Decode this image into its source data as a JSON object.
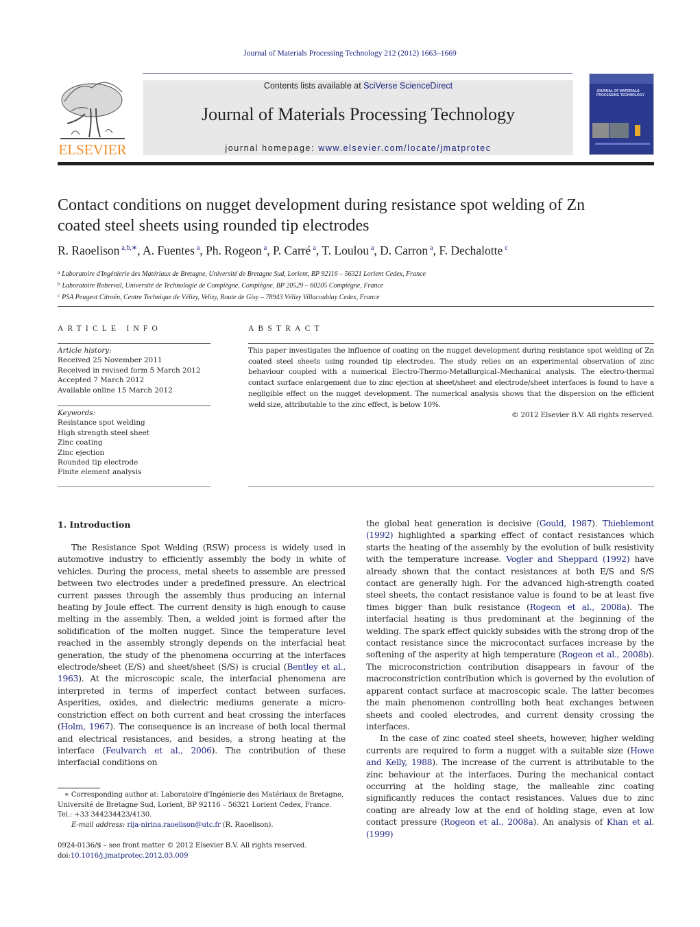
{
  "running_head": "Journal of Materials Processing Technology 212 (2012) 1663–1669",
  "masthead": {
    "contents_prefix": "Contents lists available at ",
    "contents_link": "SciVerse ScienceDirect",
    "journal_name": "Journal of Materials Processing Technology",
    "homepage_prefix": "journal homepage: ",
    "homepage_link": "www.elsevier.com/locate/jmatprotec",
    "publisher_logo_text": "ELSEVIER",
    "cover_title": "JOURNAL OF MATERIALS PROCESSING TECHNOLOGY"
  },
  "colors": {
    "link": "#1a237e",
    "elsevier_orange": "#f28c28",
    "masthead_bg": "#e8e8e8",
    "cover_blue": "#2b3a8f"
  },
  "article": {
    "title_line1": "Contact conditions on nugget development during resistance spot welding of Zn",
    "title_line2": "coated steel sheets using rounded tip electrodes",
    "authors": [
      {
        "name": "R. Raoelison",
        "sup": "a,b,∗"
      },
      {
        "name": "A. Fuentes",
        "sup": "a"
      },
      {
        "name": "Ph. Rogeon",
        "sup": "a"
      },
      {
        "name": "P. Carré",
        "sup": "a"
      },
      {
        "name": "T. Loulou",
        "sup": "a"
      },
      {
        "name": "D. Carron",
        "sup": "a"
      },
      {
        "name": "F. Dechalotte",
        "sup": "c"
      }
    ],
    "affiliations": [
      {
        "key": "a",
        "text": "Laboratoire d'Ingénierie des Matériaux de Bretagne, Université de Bretagne Sud, Lorient, BP 92116 – 56321 Lorient Cedex, France"
      },
      {
        "key": "b",
        "text": "Laboratoire Roberval, Université de Technologie de Compiègne, Compiègne, BP 20529 – 60205 Compiègne, France"
      },
      {
        "key": "c",
        "text": "PSA Peugeot Citroën, Centre Technique de Vélizy, Velizy, Route de Gisy – 78943 Vélizy Villacoublay Cedex, France"
      }
    ]
  },
  "article_info": {
    "heading": "ARTICLE INFO",
    "history_label": "Article history:",
    "history": [
      "Received 25 November 2011",
      "Received in revised form 5 March 2012",
      "Accepted 7 March 2012",
      "Available online 15 March 2012"
    ],
    "keywords_label": "Keywords:",
    "keywords": [
      "Resistance spot welding",
      "High strength steel sheet",
      "Zinc coating",
      "Zinc ejection",
      "Rounded tip electrode",
      "Finite element analysis"
    ]
  },
  "abstract": {
    "heading": "ABSTRACT",
    "text": "This paper investigates the influence of coating on the nugget development during resistance spot welding of Zn coated steel sheets using rounded tip electrodes. The study relies on an experimental observation of zinc behaviour coupled with a numerical Electro-Thermo-Metallurgical–Mechanical analysis. The electro-thermal contact surface enlargement due to zinc ejection at sheet/sheet and electrode/sheet interfaces is found to have a negligible effect on the nugget development. The numerical analysis shows that the dispersion on the efficient weld size, attributable to the zinc effect, is below 10%.",
    "copyright": "© 2012 Elsevier B.V. All rights reserved."
  },
  "body": {
    "section_heading": "1.  Introduction",
    "left_para": [
      {
        "t": "The Resistance Spot Welding (RSW) process is widely used in automotive industry to efficiently assembly the body in white of vehicles. During the process, metal sheets to assemble are pressed between two electrodes under a predefined pressure. An electrical current passes through the assembly thus producing an internal heating by Joule effect. The current density is high enough to cause melting in the assembly. Then, a welded joint is formed after the solidification of the molten nugget. Since the temperature level reached in the assembly strongly depends on the interfacial heat generation, the study of the phenomena occurring at the interfaces electrode/sheet (E/S) and sheet/sheet (S/S) is crucial ("
      },
      {
        "link": "Bentley et al., 1963"
      },
      {
        "t": "). At the microscopic scale, the interfacial phenomena are interpreted in terms of imperfect contact between surfaces. Asperities, oxides, and dielectric mediums generate a micro-constriction effect on both current and heat crossing the interfaces ("
      },
      {
        "link": "Holm, 1967"
      },
      {
        "t": "). The consequence is an increase of both local thermal and electrical resistances, and besides, a strong heating at the interface ("
      },
      {
        "link": "Feulvarch et al., 2006"
      },
      {
        "t": "). The contribution of these interfacial conditions on"
      }
    ],
    "right_para1": [
      {
        "t": "the global heat generation is decisive ("
      },
      {
        "link": "Gould, 1987"
      },
      {
        "t": "). "
      },
      {
        "link": "Thieblemont (1992)"
      },
      {
        "t": " highlighted a sparking effect of contact resistances which starts the heating of the assembly by the evolution of bulk resistivity with the temperature increase. "
      },
      {
        "link": "Vogler and Sheppard (1992)"
      },
      {
        "t": " have already shown that the contact resistances at both E/S and S/S contact are generally high. For the advanced high-strength coated steel sheets, the contact resistance value is found to be at least five times bigger than bulk resistance ("
      },
      {
        "link": "Rogeon et al., 2008a"
      },
      {
        "t": "). The interfacial heating is thus predominant at the beginning of the welding. The spark effect quickly subsides with the strong drop of the contact resistance since the microcontact surfaces increase by the softening of the asperity at high temperature ("
      },
      {
        "link": "Rogeon et al., 2008b"
      },
      {
        "t": "). The microconstriction contribution disappears in favour of the macroconstriction contribution which is governed by the evolution of apparent contact surface at macroscopic scale. The latter becomes the main phenomenon controlling both heat exchanges between sheets and cooled electrodes, and current density crossing the interfaces."
      }
    ],
    "right_para2": [
      {
        "t": "In the case of zinc coated steel sheets, however, higher welding currents are required to form a nugget with a suitable size ("
      },
      {
        "link": "Howe and Kelly, 1988"
      },
      {
        "t": "). The increase of the current is attributable to the zinc behaviour at the interfaces. During the mechanical contact occurring at the holding stage, the malleable zinc coating significantly reduces the contact resistances. Values due to zinc coating are already low at the end of holding stage, even at low contact pressure ("
      },
      {
        "link": "Rogeon et al., 2008a"
      },
      {
        "t": "). An analysis of "
      },
      {
        "link": "Khan et al. (1999)"
      }
    ]
  },
  "footnotes": {
    "corresponding": "∗ Corresponding author at: Laboratoire d'Ingénierie des Matériaux de Bretagne, Université de Bretagne Sud, Lorient, BP 92116 – 56321 Lorient Cedex, France. Tel.: +33 344234423/4130.",
    "email_label": "E-mail address: ",
    "email": "rija-nirina.raoelison@utc.fr",
    "email_suffix": " (R. Raoelison).",
    "front_matter": "0924-0136/$ – see front matter © 2012 Elsevier B.V. All rights reserved.",
    "doi_prefix": "doi:",
    "doi": "10.1016/j.jmatprotec.2012.03.009"
  }
}
